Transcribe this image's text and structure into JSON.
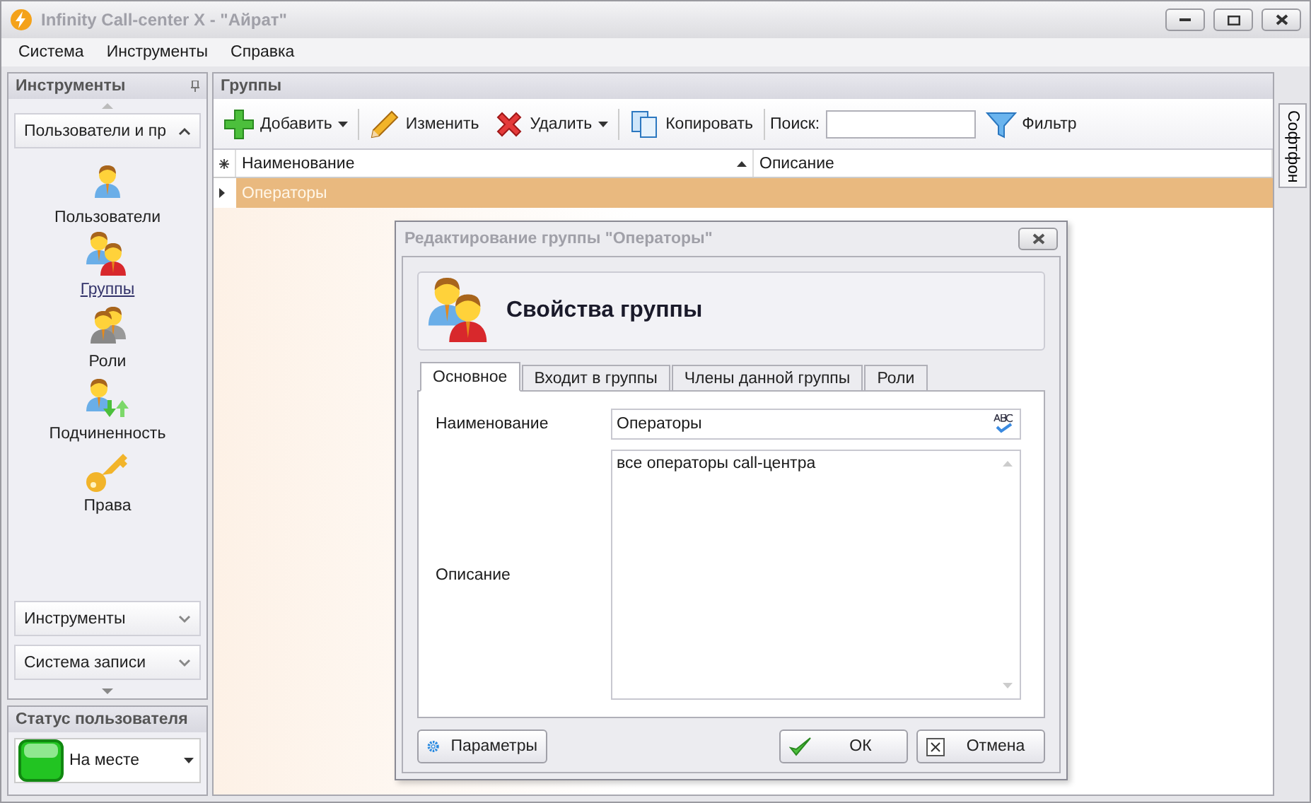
{
  "window": {
    "title": "Infinity Call-center X - \"Айрат\""
  },
  "menu": [
    "Система",
    "Инструменты",
    "Справка"
  ],
  "sidebar": {
    "title": "Инструменты",
    "sections": [
      {
        "label": "Пользователи и пр",
        "expanded": true,
        "items": [
          {
            "label": "Пользователи",
            "selected": false
          },
          {
            "label": "Группы",
            "selected": true
          },
          {
            "label": "Роли",
            "selected": false
          },
          {
            "label": "Подчиненность",
            "selected": false
          },
          {
            "label": "Права",
            "selected": false
          }
        ]
      },
      {
        "label": "Инструменты",
        "expanded": false
      },
      {
        "label": "Система записи",
        "expanded": false
      }
    ]
  },
  "user_status": {
    "title": "Статус пользователя",
    "value": "На месте"
  },
  "main": {
    "title": "Группы",
    "toolbar": [
      {
        "label": "Добавить",
        "dropdown": true
      },
      {
        "label": "Изменить",
        "dropdown": false
      },
      {
        "label": "Удалить",
        "dropdown": true
      },
      {
        "label": "Копировать",
        "dropdown": false
      }
    ],
    "search": {
      "label": "Поиск:"
    },
    "filter": "Фильтр",
    "table": {
      "columns": [
        {
          "label": "Наименование",
          "sorted": true
        },
        {
          "label": "Описание",
          "sorted": false
        }
      ],
      "rows": [
        {
          "name": "Операторы",
          "selected": true
        }
      ]
    }
  },
  "side_tab": "Софтфон",
  "dialog": {
    "title": "Редактирование группы \"Операторы\"",
    "header": "Свойства группы",
    "tabs": [
      {
        "label": "Основное",
        "selected": true
      },
      {
        "label": "Входит в группы",
        "selected": false
      },
      {
        "label": "Члены данной группы",
        "selected": false
      },
      {
        "label": "Роли",
        "selected": false
      }
    ],
    "fields": [
      {
        "label": "Наименование",
        "value": "Операторы",
        "kind": "input"
      },
      {
        "label": "Описание",
        "value": "все операторы call-центра",
        "kind": "textarea"
      }
    ],
    "buttons": [
      {
        "label": "Параметры",
        "kind": "settings"
      },
      {
        "label": "ОК",
        "kind": "ok"
      },
      {
        "label": "Отмена",
        "kind": "cancel"
      }
    ]
  }
}
